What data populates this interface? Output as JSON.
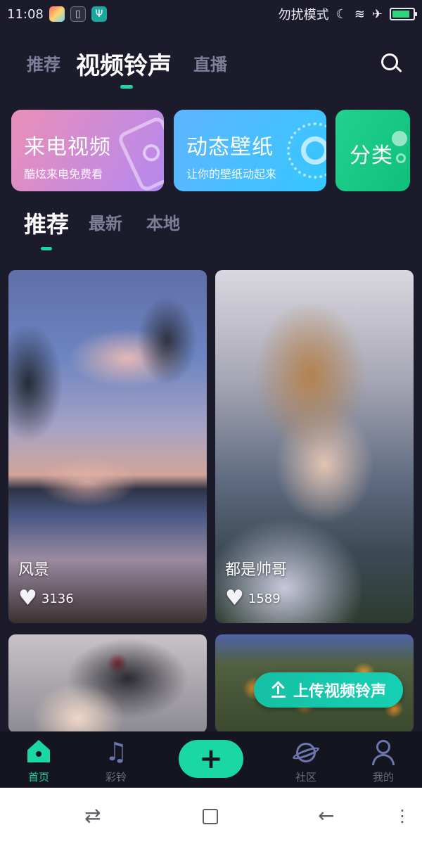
{
  "status_bar": {
    "time": "11:08",
    "dnd_text": "勿扰模式",
    "icons": [
      "flower-app-icon",
      "brush-icon",
      "usb-icon",
      "moon-icon",
      "wifi-icon",
      "airplane-icon",
      "battery-icon"
    ],
    "battery_level": 0.85
  },
  "top_tabs": {
    "items": [
      "推荐",
      "视频铃声",
      "直播"
    ],
    "active": "视频铃声"
  },
  "feature_cards": [
    {
      "title": "来电视频",
      "subtitle": "酷炫来电免费看"
    },
    {
      "title": "动态壁纸",
      "subtitle": "让你的壁纸动起来"
    },
    {
      "title": "分类",
      "subtitle": ""
    }
  ],
  "sub_tabs": {
    "items": [
      "推荐",
      "最新",
      "本地"
    ],
    "active": "推荐"
  },
  "grid": [
    {
      "caption": "风景",
      "likes": "3136"
    },
    {
      "caption": "都是帅哥",
      "likes": "1589"
    },
    {
      "caption": "",
      "likes": ""
    },
    {
      "caption": "",
      "likes": ""
    }
  ],
  "upload_button": {
    "label": "上传视频铃声"
  },
  "bottom_nav": {
    "home": "首页",
    "ringtone": "彩铃",
    "add": "+",
    "community": "社区",
    "mine": "我的"
  },
  "colors": {
    "accent": "#1bd7a3",
    "background": "#1b1b2b",
    "inactive": "#7e7e99"
  }
}
